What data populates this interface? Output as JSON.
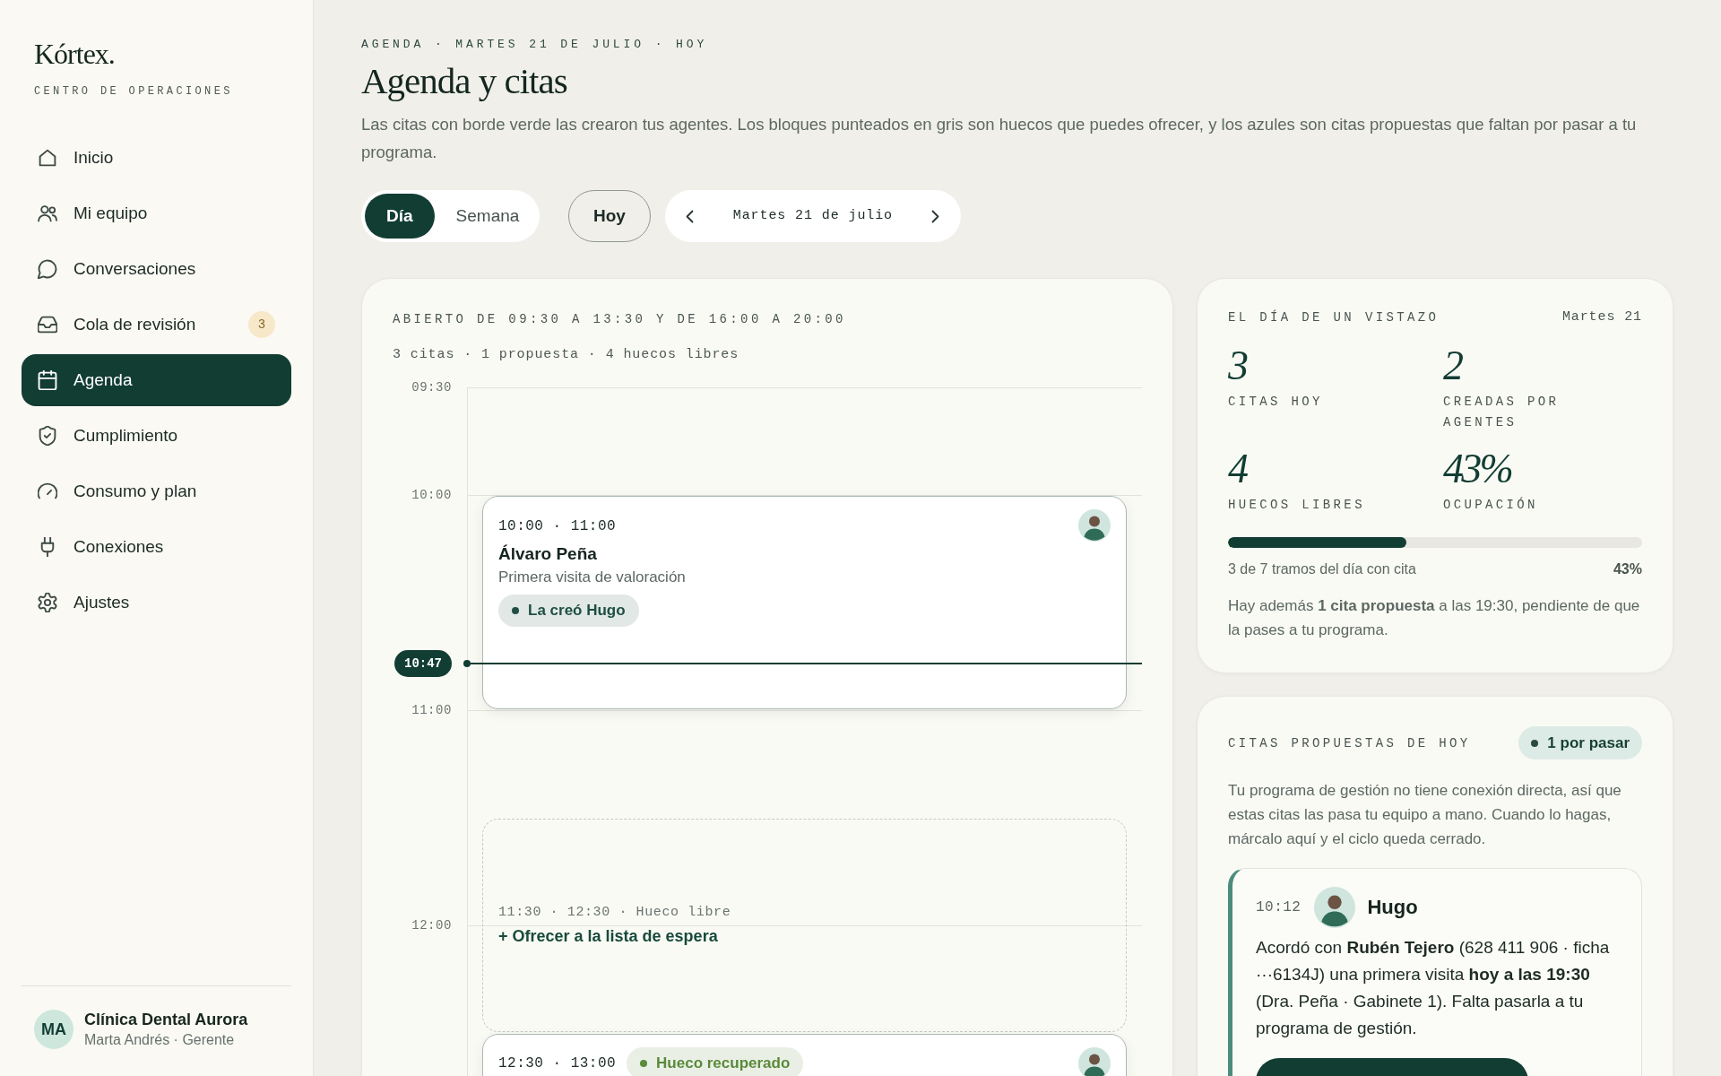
{
  "sidebar": {
    "logo": "Kórtex.",
    "subtitle": "CENTRO DE OPERACIONES",
    "items": [
      {
        "label": "Inicio",
        "selected": false
      },
      {
        "label": "Mi equipo",
        "selected": false
      },
      {
        "label": "Conversaciones",
        "selected": false
      },
      {
        "label": "Cola de revisión",
        "badge": "3",
        "selected": false
      },
      {
        "label": "Agenda",
        "selected": true
      },
      {
        "label": "Cumplimiento",
        "selected": false
      },
      {
        "label": "Consumo y plan",
        "selected": false
      },
      {
        "label": "Conexiones",
        "selected": false
      },
      {
        "label": "Ajustes",
        "selected": false
      }
    ],
    "account": {
      "initials": "MA",
      "name": "Clínica Dental Aurora",
      "role": "Marta Andrés · Gerente"
    }
  },
  "header": {
    "breadcrumb": "AGENDA · MARTES 21 DE JULIO · HOY",
    "title": "Agenda y citas",
    "description": "Las citas con borde verde las crearon tus agentes. Los bloques punteados en gris son huecos que puedes ofrecer, y los azules son citas propuestas que faltan por pasar a tu programa."
  },
  "toolbar": {
    "views": [
      {
        "label": "Día",
        "selected": true
      },
      {
        "label": "Semana",
        "selected": false
      }
    ],
    "today_button": "Hoy",
    "date": "Martes 21 de julio"
  },
  "calendar": {
    "hours": "ABIERTO DE 09:30 A 13:30 Y DE 16:00 A 20:00",
    "summary": "3 citas · 1 propuesta · 4 huecos libres",
    "time_labels": [
      "09:30",
      "10:00",
      "11:00",
      "12:00"
    ],
    "now": "10:47",
    "events": [
      {
        "kind": "appointment",
        "time": "10:00 · 11:00",
        "name": "Álvaro Peña",
        "description": "Primera visita de valoración",
        "tag": {
          "label": "La creó Hugo",
          "color": "#1f4f42"
        }
      },
      {
        "kind": "free_slot",
        "time": "11:30 · 12:30 · Hueco libre",
        "action": "+ Ofrecer a la lista de espera"
      },
      {
        "kind": "appointment",
        "time": "12:30 · 13:00",
        "tag": {
          "label": "Hueco recuperado",
          "color": "#5a8a3a"
        }
      }
    ]
  },
  "overview": {
    "title": "EL DÍA DE UN VISTAZO",
    "date": "Martes 21",
    "stats": [
      {
        "value": "3",
        "label": "CITAS HOY"
      },
      {
        "value": "2",
        "label": "CREADAS POR AGENTES"
      },
      {
        "value": "4",
        "label": "HUECOS LIBRES"
      },
      {
        "value": "43%",
        "label": "OCUPACIÓN"
      }
    ],
    "occupancy": {
      "level": 0.43,
      "caption": "3 de 7 tramos del día con cita",
      "reading": "43%"
    },
    "note": "Hay además **1 cita propuesta** a las 19:30, pendiente de que la pases a tu programa."
  },
  "proposals": {
    "title": "CITAS PROPUESTAS DE HOY",
    "badge": "1 por pasar",
    "intro": "Tu programa de gestión no tiene conexión directa, así que estas citas las pasa tu equipo a mano. Cuando lo hagas, márcalo aquí y el ciclo queda cerrado.",
    "items": [
      {
        "time": "10:12",
        "agent": "Hugo",
        "text": "Acordó con **Rubén Tejero** (628 411 906 · ficha ···6134J) una primera visita **hoy a las 19:30** (Dra. Peña · Gabinete 1). Falta pasarla a tu programa de gestión."
      }
    ]
  }
}
